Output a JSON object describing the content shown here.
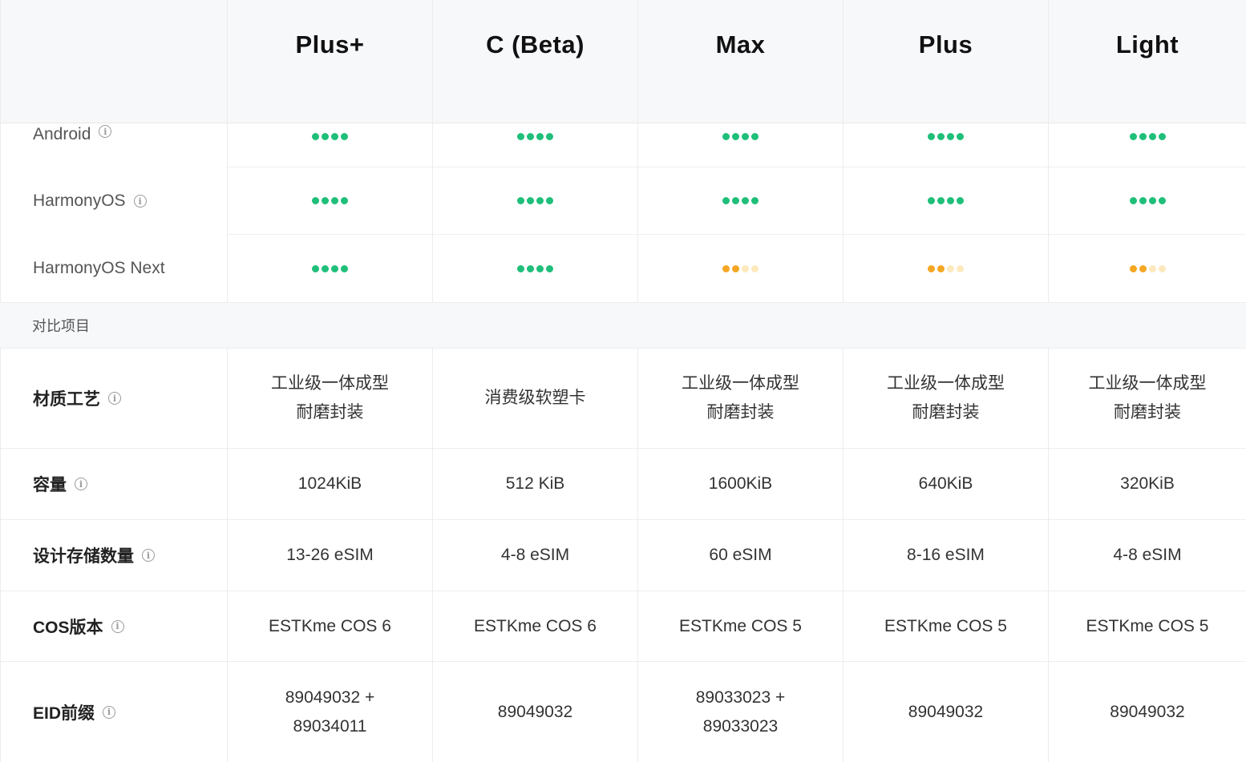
{
  "colors": {
    "full": "#1fbf7a",
    "partial": "#f5a623",
    "partial_faint": "#fde9bd"
  },
  "plans": [
    "Plus+",
    "C (Beta)",
    "Max",
    "Plus",
    "Light"
  ],
  "compatibility": [
    {
      "label": "Android",
      "info_icon": true,
      "ratings": [
        4,
        4,
        4,
        4,
        4
      ]
    },
    {
      "label": "HarmonyOS",
      "info_icon": true,
      "ratings": [
        4,
        4,
        4,
        4,
        4
      ]
    },
    {
      "label": "HarmonyOS Next",
      "info_icon": false,
      "ratings": [
        4,
        4,
        2,
        2,
        2
      ]
    }
  ],
  "rating_scale": 4,
  "section_title": "对比项目",
  "specs": [
    {
      "label": "材质工艺",
      "values": [
        "工业级一体成型\n耐磨封装",
        "消费级软塑卡",
        "工业级一体成型\n耐磨封装",
        "工业级一体成型\n耐磨封装",
        "工业级一体成型\n耐磨封装"
      ]
    },
    {
      "label": "容量",
      "values": [
        "1024KiB",
        "512 KiB",
        "1600KiB",
        "640KiB",
        "320KiB"
      ]
    },
    {
      "label": "设计存储数量",
      "values": [
        "13-26 eSIM",
        "4-8 eSIM",
        "60 eSIM",
        "8-16 eSIM",
        "4-8 eSIM"
      ]
    },
    {
      "label": "COS版本",
      "values": [
        "ESTKme COS 6",
        "ESTKme COS 6",
        "ESTKme COS 5",
        "ESTKme COS 5",
        "ESTKme COS 5"
      ]
    },
    {
      "label": "EID前缀",
      "values": [
        "89049032 +\n89034011",
        "89049032",
        "89033023 +\n89033023",
        "89049032",
        "89049032"
      ]
    }
  ]
}
